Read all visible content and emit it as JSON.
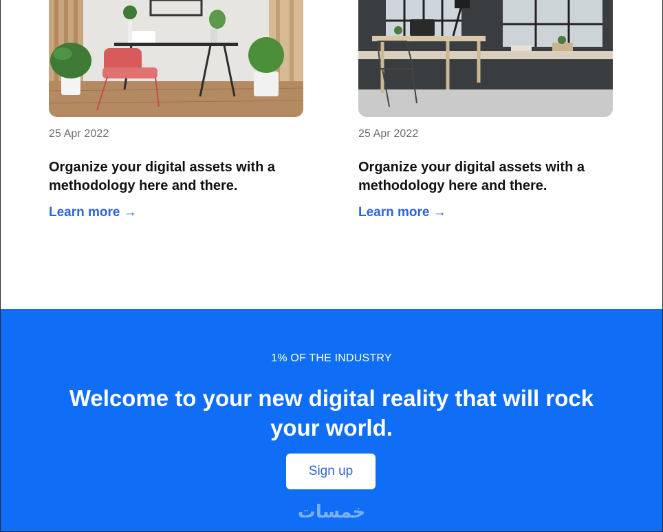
{
  "posts": [
    {
      "date": "25 Apr 2022",
      "title": "Organize your digital assets with a methodology here and there.",
      "link_label": "Learn more →",
      "image": "home-office-red-chair-photo"
    },
    {
      "date": "25 Apr 2022",
      "title": "Organize your digital assets with a methodology here and there.",
      "link_label": "Learn more →",
      "image": "loft-office-desk-photo"
    }
  ],
  "cta": {
    "eyebrow": "1% OF THE INDUSTRY",
    "headline": "Welcome to your new digital reality that will rock your world.",
    "button_label": "Sign up",
    "watermark": "خمسات"
  },
  "colors": {
    "accent": "#0f6ef5",
    "link": "#2f63d8",
    "date_text": "#6c6c6c"
  }
}
